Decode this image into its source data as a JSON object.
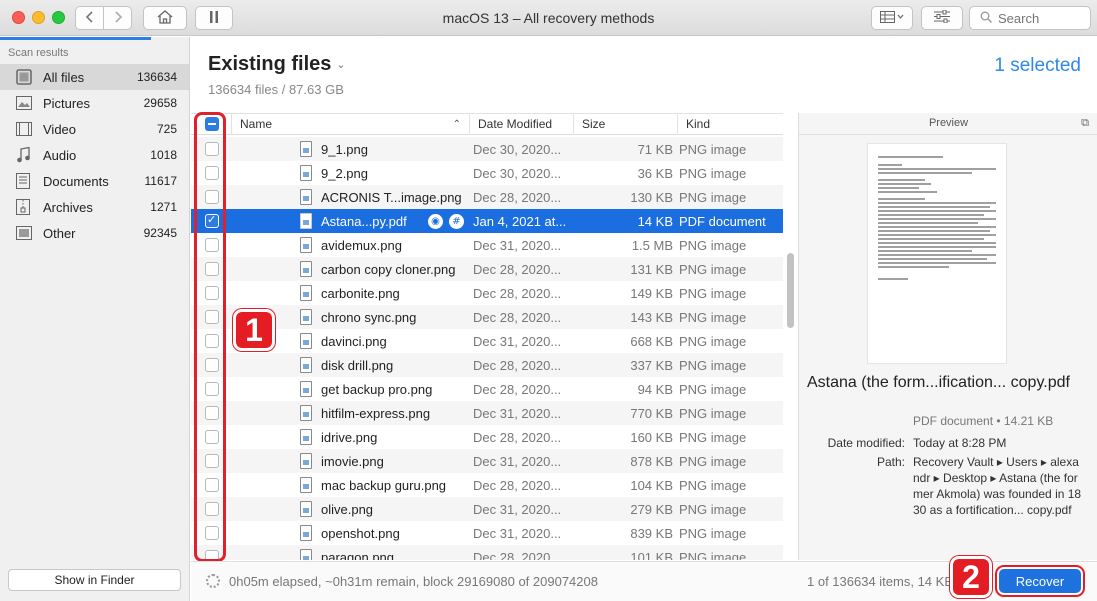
{
  "window": {
    "title": "macOS 13 – All recovery methods"
  },
  "toolbar": {
    "search_placeholder": "Search"
  },
  "sidebar": {
    "heading": "Scan results",
    "items": [
      {
        "label": "All files",
        "count": "136634",
        "icon": "files-icon"
      },
      {
        "label": "Pictures",
        "count": "29658",
        "icon": "pictures-icon"
      },
      {
        "label": "Video",
        "count": "725",
        "icon": "video-icon"
      },
      {
        "label": "Audio",
        "count": "1018",
        "icon": "audio-icon"
      },
      {
        "label": "Documents",
        "count": "11617",
        "icon": "documents-icon"
      },
      {
        "label": "Archives",
        "count": "1271",
        "icon": "archives-icon"
      },
      {
        "label": "Other",
        "count": "92345",
        "icon": "other-icon"
      }
    ],
    "show_in_finder": "Show in Finder"
  },
  "main": {
    "title": "Existing files",
    "subtitle": "136634 files / 87.63 GB",
    "selected": "1 selected"
  },
  "table": {
    "columns": {
      "name": "Name",
      "date": "Date Modified",
      "size": "Size",
      "kind": "Kind"
    },
    "rows": [
      {
        "name": "9_1.png",
        "date": "Dec 30, 2020...",
        "size": "71 KB",
        "kind": "PNG image"
      },
      {
        "name": "9_2.png",
        "date": "Dec 30, 2020...",
        "size": "36 KB",
        "kind": "PNG image"
      },
      {
        "name": "ACRONIS T...image.png",
        "date": "Dec 28, 2020...",
        "size": "130 KB",
        "kind": "PNG image"
      },
      {
        "name": "Astana...py.pdf",
        "date": "Jan 4, 2021 at...",
        "size": "14 KB",
        "kind": "PDF document"
      },
      {
        "name": "avidemux.png",
        "date": "Dec 31, 2020...",
        "size": "1.5 MB",
        "kind": "PNG image"
      },
      {
        "name": "carbon copy cloner.png",
        "date": "Dec 28, 2020...",
        "size": "131 KB",
        "kind": "PNG image"
      },
      {
        "name": "carbonite.png",
        "date": "Dec 28, 2020...",
        "size": "149 KB",
        "kind": "PNG image"
      },
      {
        "name": "chrono sync.png",
        "date": "Dec 28, 2020...",
        "size": "143 KB",
        "kind": "PNG image"
      },
      {
        "name": "davinci.png",
        "date": "Dec 31, 2020...",
        "size": "668 KB",
        "kind": "PNG image"
      },
      {
        "name": "disk drill.png",
        "date": "Dec 28, 2020...",
        "size": "337 KB",
        "kind": "PNG image"
      },
      {
        "name": "get backup pro.png",
        "date": "Dec 28, 2020...",
        "size": "94 KB",
        "kind": "PNG image"
      },
      {
        "name": "hitfilm-express.png",
        "date": "Dec 31, 2020...",
        "size": "770 KB",
        "kind": "PNG image"
      },
      {
        "name": "idrive.png",
        "date": "Dec 28, 2020...",
        "size": "160 KB",
        "kind": "PNG image"
      },
      {
        "name": "imovie.png",
        "date": "Dec 31, 2020...",
        "size": "878 KB",
        "kind": "PNG image"
      },
      {
        "name": "mac backup guru.png",
        "date": "Dec 28, 2020...",
        "size": "104 KB",
        "kind": "PNG image"
      },
      {
        "name": "olive.png",
        "date": "Dec 31, 2020...",
        "size": "279 KB",
        "kind": "PNG image"
      },
      {
        "name": "openshot.png",
        "date": "Dec 31, 2020...",
        "size": "839 KB",
        "kind": "PNG image"
      },
      {
        "name": "paragon.png",
        "date": "Dec 28, 2020...",
        "size": "101 KB",
        "kind": "PNG image"
      }
    ]
  },
  "preview": {
    "heading": "Preview",
    "file_name": "Astana (the form...ification... copy.pdf",
    "kind_size": "PDF document • 14.21 KB",
    "date_label": "Date modified:",
    "date_value": "Today at 8:28 PM",
    "path_label": "Path:",
    "path_value": "Recovery Vault ▸ Users ▸ alexandr ▸ Desktop ▸ Astana (the former Akmola) was founded in 1830 as a fortification... copy.pdf"
  },
  "footer": {
    "status": "0h05m elapsed, ~0h31m remain, block 29169080 of 209074208",
    "items": "1 of 136634 items, 14 KB",
    "recover": "Recover"
  },
  "annotations": {
    "badge1": "1",
    "badge2": "2",
    "color": "#e41d24"
  }
}
